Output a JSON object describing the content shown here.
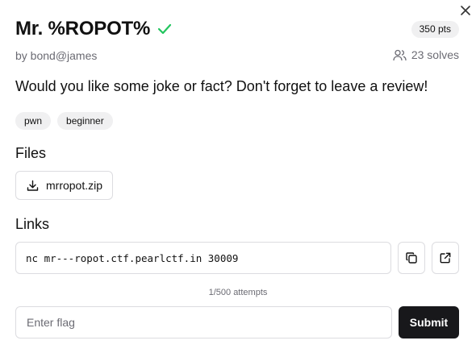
{
  "challenge": {
    "title": "Mr. %ROPOT%",
    "points": "350 pts",
    "author": "by bond@james",
    "solves": "23 solves",
    "description": "Would you like some joke or fact? Don't forget to leave a review!",
    "tags": [
      "pwn",
      "beginner"
    ],
    "solved": true
  },
  "files": {
    "heading": "Files",
    "items": [
      {
        "name": "mrropot.zip",
        "icon": "download-icon"
      }
    ]
  },
  "links": {
    "heading": "Links",
    "items": [
      {
        "value": "nc mr---ropot.ctf.pearlctf.in 30009"
      }
    ]
  },
  "attempts": "1/500 attempts",
  "flag": {
    "placeholder": "Enter flag",
    "value": ""
  },
  "submit_label": "Submit",
  "colors": {
    "check": "#22c55e",
    "submit_bg": "#18181b",
    "muted_text": "#6b6b73"
  }
}
